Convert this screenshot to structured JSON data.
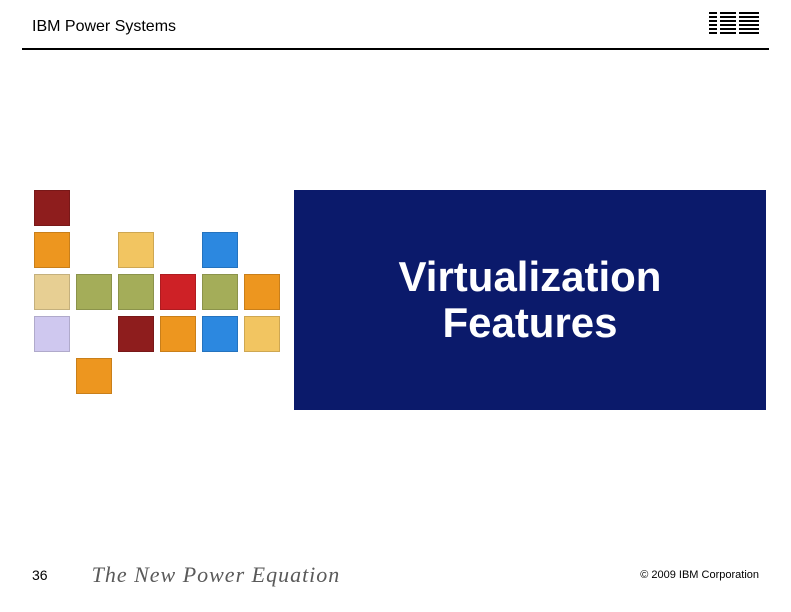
{
  "header": {
    "title": "IBM Power Systems",
    "logo_name": "ibm-logo"
  },
  "main": {
    "title": "Virtualization\nFeatures"
  },
  "footer": {
    "page_number": "36",
    "tagline": "The New Power Equation",
    "copyright": "© 2009 IBM Corporation"
  },
  "colors": {
    "title_box_bg": "#0b1a6b",
    "title_text": "#ffffff"
  }
}
